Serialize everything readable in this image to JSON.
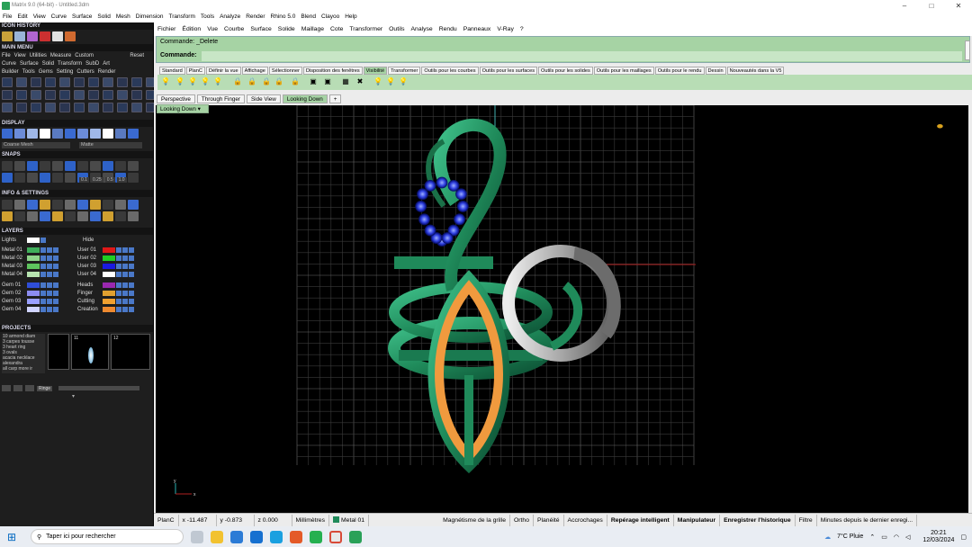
{
  "window": {
    "title": "Matrix 9.0 (64-bit) - Untitled.3dm",
    "min": "–",
    "max": "□",
    "close": "✕"
  },
  "menubar": [
    "File",
    "Edit",
    "View",
    "Curve",
    "Surface",
    "Solid",
    "Mesh",
    "Dimension",
    "Transform",
    "Tools",
    "Analyze",
    "Render",
    "Rhino 5.0",
    "Blend",
    "Clayoo",
    "Help"
  ],
  "left": {
    "icon_history": "ICON HISTORY",
    "main_menu": "MAIN MENU",
    "mm_row1": [
      "File",
      "View",
      "Utilities",
      "Measure",
      "Custom",
      "Reset"
    ],
    "mm_row2": [
      "Curve",
      "Surface",
      "Solid",
      "Transform",
      "SubD",
      "Art"
    ],
    "mm_row3": [
      "Builder",
      "Tools",
      "Gems",
      "Setting",
      "Cutters",
      "Render"
    ],
    "display": "DISPLAY",
    "display_mode_left": "Coarse Mesh",
    "display_mode_right": "Matte",
    "snaps": "SNAPS",
    "snap_values": [
      "0.1",
      "0.25",
      "0.5",
      "1.0"
    ],
    "info": "INFO & SETTINGS",
    "layers": "LAYERS",
    "lights_label": "Lights",
    "hide_label": "Hide",
    "layers_left": [
      {
        "name": "Metal 01",
        "color": "#3fae5a"
      },
      {
        "name": "Metal 02",
        "color": "#8fd48a"
      },
      {
        "name": "Metal 03",
        "color": "#5ec45e"
      },
      {
        "name": "Metal 04",
        "color": "#b7e4b1"
      },
      {
        "name": "Gem 01",
        "color": "#2f4ed8"
      },
      {
        "name": "Gem 02",
        "color": "#8c8cf0"
      },
      {
        "name": "Gem 03",
        "color": "#9aa0ff"
      },
      {
        "name": "Gem 04",
        "color": "#d0d4ff"
      }
    ],
    "layers_right": [
      {
        "name": "User 01",
        "color": "#e01818"
      },
      {
        "name": "User 02",
        "color": "#22cc22"
      },
      {
        "name": "User 03",
        "color": "#1a1ae0"
      },
      {
        "name": "User 04",
        "color": "#ffffff"
      },
      {
        "name": "Heads",
        "color": "#9a28b0"
      },
      {
        "name": "Finger",
        "color": "#e0a030"
      },
      {
        "name": "Cutting",
        "color": "#f0a030"
      },
      {
        "name": "Creation",
        "color": "#ee8a30"
      }
    ],
    "projects": "PROJECTS",
    "project_list": [
      "10 armond diam",
      "3 carpes tousse",
      "3 heart ring",
      "3 ovals",
      "acacia necklace",
      "alexandra",
      "all carp more ir"
    ],
    "thumb_nums": [
      "11",
      "12"
    ],
    "ringe_label": "Ringe"
  },
  "command": {
    "line1": "Commande: _Delete",
    "line2": "Commande:"
  },
  "tabs": [
    "Standard",
    "PlanC",
    "Définir la vue",
    "Affichage",
    "Sélectionner",
    "Disposition des fenêtres",
    "Visibilité",
    "Transformer",
    "Outils pour les courbes",
    "Outils pour les surfaces",
    "Outils pour les solides",
    "Outils pour les maillages",
    "Outils pour le rendu",
    "Dessin",
    "Nouveautés dans la V5"
  ],
  "active_tab": "Visibilité",
  "viewtabs": [
    "Perspective",
    "Through Finger",
    "Side View",
    "Looking Down",
    "+"
  ],
  "viewport_label": "Looking Down",
  "status": {
    "plane": "PlanC",
    "x": "x -11.487",
    "y": "y -0.873",
    "z": "z 0.000",
    "units": "Millimètres",
    "layer": "Metal 01",
    "items": [
      "Magnétisme de la grille",
      "Ortho",
      "Planéité",
      "Accrochages"
    ],
    "bold_items": [
      "Repérage intelligent",
      "Manipulateur",
      "Enregistrer l'historique"
    ],
    "filter": "Filtre",
    "last": "Minutes depuis le dernier enregi..."
  },
  "axis": {
    "y": "y",
    "x": "x"
  },
  "taskbar": {
    "search": "Taper ici pour rechercher",
    "weather": "7°C Pluie",
    "time": "20:21",
    "date": "12/03/2024",
    "chevron": "⌃"
  },
  "colors": {
    "panel": "#1e1e1e",
    "cmd_green": "#a6d3a4",
    "metal": "#1f8a5a",
    "gem": "#2e3fe0",
    "orange": "#f09a3e",
    "silver": "#a8a8a8"
  }
}
